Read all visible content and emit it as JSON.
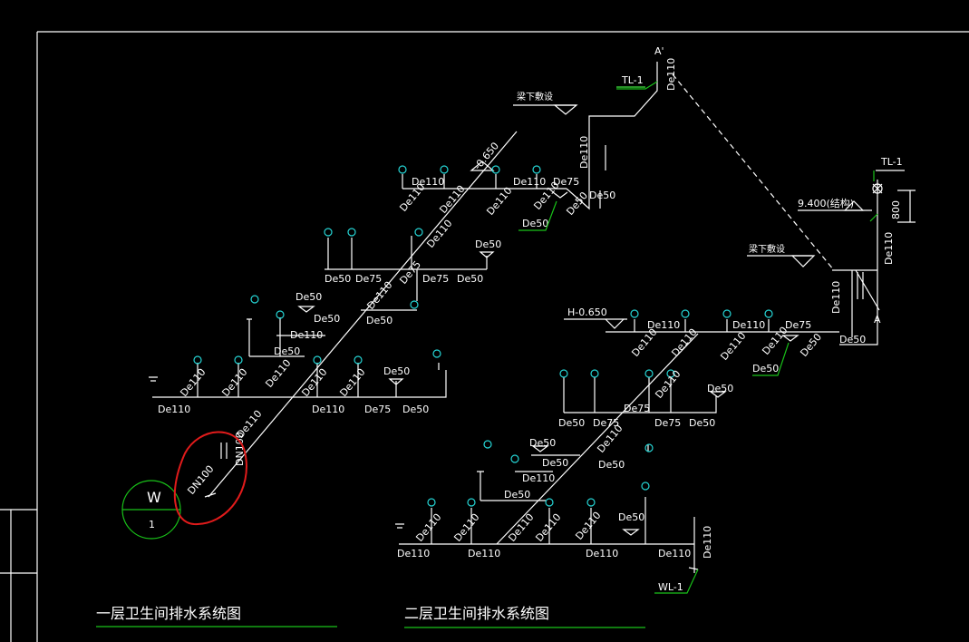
{
  "colors": {
    "background": "#000000",
    "lines": "#ffffff",
    "leaders": "#19c219",
    "fixtures": "#25d5d5",
    "markup": "#e11b1b"
  },
  "titles": {
    "floor1": "一层卫生间排水系统图",
    "floor2": "二层卫生间排水系统图"
  },
  "markers": {
    "section_top": "A'",
    "section_bottom": "A",
    "tl1_top": "TL-1",
    "tl1_right": "TL-1",
    "wl1": "WL-1",
    "beam_top": "梁下敷设",
    "beam_right": "梁下敷设",
    "elev_top": "-0.650",
    "elev_h": "H-0.650",
    "elev_940": "9.400(结构)",
    "dim_800": "800",
    "bubble_top": "W",
    "bubble_bottom": "1"
  },
  "labels": {
    "de110": "De110",
    "de75": "De75",
    "de50": "De50",
    "dn100": "DN100"
  }
}
